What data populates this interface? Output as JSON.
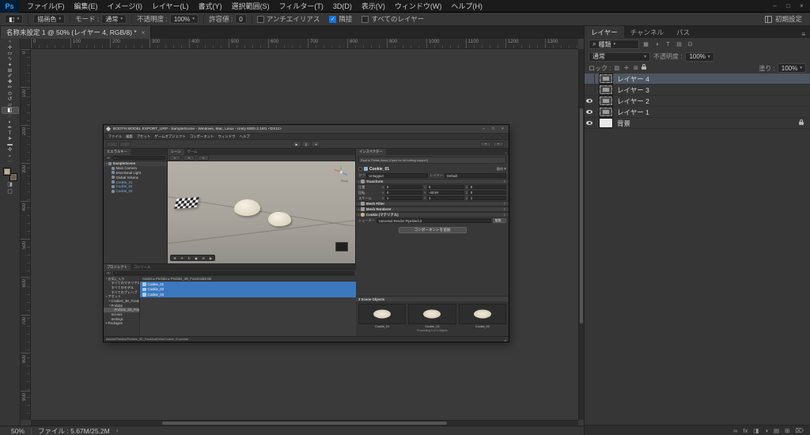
{
  "ps": {
    "logo": "Ps",
    "menus": [
      "ファイル(F)",
      "編集(E)",
      "イメージ(I)",
      "レイヤー(L)",
      "書式(Y)",
      "選択範囲(S)",
      "フィルター(T)",
      "3D(D)",
      "表示(V)",
      "ウィンドウ(W)",
      "ヘルプ(H)"
    ],
    "window_controls": [
      "–",
      "□",
      "×"
    ],
    "icons": {
      "caret": "▾",
      "dbl_arrow": "»",
      "check": "✓",
      "search": "⌕",
      "panel_menu": "≡",
      "chevron": "›",
      "tool_preset_glyph": "◧"
    },
    "options": {
      "fill_source": "描画色",
      "mode_label": "モード :",
      "mode_value": "通常",
      "opacity_label": "不透明度 :",
      "opacity_value": "100%",
      "tolerance_label": "許容値 :",
      "tolerance_value": "0",
      "checkbox_antialias": "アンチエイリアス",
      "checkbox_contiguous": "隣接",
      "checkbox_all_layers": "すべてのレイヤー",
      "workspace": "初期設定"
    },
    "document_tab": {
      "title": "名称未設定 1 @ 50% (レイヤー 4, RGB/8) *",
      "close": "×"
    },
    "tools": [
      {
        "name": "move-tool-icon",
        "glyph": "✛"
      },
      {
        "name": "marquee-tool-icon",
        "glyph": "▭"
      },
      {
        "name": "lasso-tool-icon",
        "glyph": "∿"
      },
      {
        "name": "magic-wand-tool-icon",
        "glyph": "✦"
      },
      {
        "name": "crop-tool-icon",
        "glyph": "⊞"
      },
      {
        "name": "eyedropper-tool-icon",
        "glyph": "✐"
      },
      {
        "name": "healing-brush-tool-icon",
        "glyph": "✚"
      },
      {
        "name": "brush-tool-icon",
        "glyph": "✏"
      },
      {
        "name": "clone-stamp-tool-icon",
        "glyph": "⊙"
      },
      {
        "name": "history-brush-tool-icon",
        "glyph": "↺"
      },
      {
        "name": "eraser-tool-icon",
        "glyph": "▱"
      },
      {
        "name": "paint-bucket-tool-icon",
        "glyph": "◧",
        "selected": true
      },
      {
        "name": "blur-tool-icon",
        "glyph": "◌"
      },
      {
        "name": "dodge-tool-icon",
        "glyph": "◐"
      },
      {
        "name": "pen-tool-icon",
        "glyph": "✒"
      },
      {
        "name": "type-tool-icon",
        "glyph": "T"
      },
      {
        "name": "path-select-tool-icon",
        "glyph": "➤"
      },
      {
        "name": "shape-tool-icon",
        "glyph": "▬"
      },
      {
        "name": "hand-tool-icon",
        "glyph": "✣"
      },
      {
        "name": "zoom-tool-icon",
        "glyph": "⌕"
      }
    ],
    "toolbar_more": "⋯",
    "swatches": {
      "foreground": "#c2ad8a",
      "background": "#6e5e44"
    },
    "rulers": {
      "top": [
        "0",
        "100",
        "200",
        "300",
        "400",
        "500",
        "600",
        "700",
        "800",
        "900",
        "1000",
        "1100",
        "1200",
        "1300"
      ],
      "left": [
        "0",
        "100",
        "200",
        "300",
        "400",
        "500",
        "600",
        "700",
        "800",
        "900"
      ]
    },
    "layers_panel": {
      "tabs": [
        {
          "label": "レイヤー",
          "active": true
        },
        {
          "label": "チャンネル"
        },
        {
          "label": "パス"
        }
      ],
      "filter_label": "種類",
      "filter_icons": [
        "▦",
        "◑",
        "T",
        "▤",
        "⊡"
      ],
      "blend_mode": "通常",
      "opacity_label": "不透明度 :",
      "opacity_value": "100%",
      "lock_label": "ロック :",
      "lock_icons": [
        "▨",
        "✛",
        "⊞"
      ],
      "fill_label": "塗り :",
      "fill_value": "100%",
      "layers": [
        {
          "name": "レイヤー 4",
          "selected": true,
          "eye_off": true
        },
        {
          "name": "レイヤー 3",
          "eye_off": true
        },
        {
          "name": "レイヤー 2"
        },
        {
          "name": "レイヤー 1"
        },
        {
          "name": "背景",
          "is_bg": true,
          "locked": true
        }
      ],
      "bottom_icons": [
        {
          "name": "link-layers-icon",
          "glyph": "∞"
        },
        {
          "name": "layer-style-icon",
          "glyph": "fx"
        },
        {
          "name": "layer-mask-icon",
          "glyph": "◨"
        },
        {
          "name": "adjustment-layer-icon",
          "glyph": "◑"
        },
        {
          "name": "layer-group-icon",
          "glyph": "▤"
        },
        {
          "name": "new-layer-icon",
          "glyph": "⊞"
        },
        {
          "name": "delete-layer-icon",
          "glyph": "⌦"
        }
      ]
    },
    "status_bar": {
      "zoom": "50%",
      "file_info": "ファイル : 5.67M/25.2M",
      "expander": "›"
    }
  },
  "unity": {
    "title": "BOOTH MODEL EXPORT_URP - SampleScene - Windows, Mac, Linux - Unity 6000.2.16f1 <DX11>",
    "window_controls": [
      "–",
      "□",
      "×"
    ],
    "menus": [
      "ファイル",
      "編集",
      "アセット",
      "ゲームオブジェクト",
      "コンポーネント",
      "ウィンドウ",
      "ヘルプ"
    ],
    "transport": [
      "▶",
      "∥",
      "⇥"
    ],
    "icons": {
      "caret": "▾",
      "search": "⌕",
      "plus": "+",
      "dots": "⋮",
      "menu": "≡",
      "grip": "◢"
    },
    "hierarchy": {
      "tab": "ヒエラルキー",
      "items": [
        {
          "label": "SampleScene",
          "depth": 0,
          "arrow": "▼",
          "scene": true
        },
        {
          "label": "Main Camera",
          "depth": 1
        },
        {
          "label": "Directional Light",
          "depth": 1
        },
        {
          "label": "Global Volume",
          "depth": 1
        },
        {
          "label": "Cookie_01",
          "depth": 1,
          "blue": true
        },
        {
          "label": "Cookie_02",
          "depth": 1,
          "blue": true
        },
        {
          "label": "Cookie_03",
          "depth": 1,
          "blue": true
        }
      ]
    },
    "scene": {
      "tabs": [
        {
          "label": "シーン",
          "active": true
        },
        {
          "label": "ゲーム"
        }
      ],
      "gizmo_label": "Persp",
      "tools": [
        {
          "name": "view-tool-icon",
          "glyph": "✥"
        },
        {
          "name": "move-tool-icon",
          "glyph": "✛"
        },
        {
          "name": "rotate-tool-icon",
          "glyph": "↻"
        },
        {
          "name": "scale-tool-icon",
          "glyph": "▣"
        },
        {
          "name": "rect-tool-icon",
          "glyph": "⊞"
        },
        {
          "name": "transform-tool-icon",
          "glyph": "◉"
        }
      ]
    },
    "inspector": {
      "tab": "インスペクター",
      "prefab_notice": "Root in Prefab Asset (Open for full editing support)",
      "object_name": "Cookie_01",
      "static_label": "静的",
      "tag_label": "タグ",
      "tag_value": "Untagged",
      "layer_label": "レイヤー",
      "layer_value": "Default",
      "transform": {
        "title": "Transform",
        "axis_labels": [
          "X",
          "Y",
          "Z"
        ],
        "rows": [
          {
            "label": "位置",
            "x": "0",
            "y": "0",
            "z": "0"
          },
          {
            "label": "回転",
            "x": "0",
            "y": "-43.94",
            "z": "0"
          },
          {
            "label": "スケール",
            "x": "1",
            "y": "1",
            "z": "1"
          }
        ]
      },
      "components": [
        {
          "title": "Mesh Filter"
        },
        {
          "title": "Mesh Renderer"
        },
        {
          "title": "Cookie (マテリアル)"
        }
      ],
      "shader_label": "シェーダー",
      "shader_value": "Universal Render Pipeline/Lit",
      "shader_edit": "編集...",
      "add_component": "コンポーネントを追加",
      "preview_header": "3 Scene Objects",
      "previews": [
        {
          "name": "Cookie_01"
        },
        {
          "name": "Cookie_02",
          "note": "Processing 3 of 3 Objects"
        },
        {
          "name": "Cookie_03"
        }
      ]
    },
    "project": {
      "tabs": [
        {
          "label": "プロジェクト",
          "active": true
        },
        {
          "label": "コンソール"
        }
      ],
      "tree": [
        {
          "label": "お気に入り",
          "depth": 0,
          "arrow": "▼"
        },
        {
          "label": "すべてのマテリアル",
          "depth": 1
        },
        {
          "label": "すべてのモデル",
          "depth": 1
        },
        {
          "label": "すべてのプレハブ",
          "depth": 1
        },
        {
          "label": "アセット",
          "depth": 0,
          "arrow": "▼"
        },
        {
          "label": "Cookies_3D_FoodAndDrink",
          "depth": 1,
          "arrow": "▶"
        },
        {
          "label": "Prefabs",
          "depth": 1,
          "arrow": "▼"
        },
        {
          "label": "Prefabs_3D_FoodAndDrink",
          "depth": 2,
          "selected": true
        },
        {
          "label": "Scenes",
          "depth": 1
        },
        {
          "label": "Settings",
          "depth": 1
        },
        {
          "label": "Packages",
          "depth": 0,
          "arrow": "▶"
        }
      ],
      "breadcrumb": "Assets ▸ Prefabs ▸ Prefabs_3D_FoodAndDrink",
      "files": [
        {
          "name": "Cookie_01",
          "selected": true
        },
        {
          "name": "Cookie_02",
          "selected": true
        },
        {
          "name": "Cookie_03",
          "selected": true
        }
      ],
      "path": "Assets/Prefabs/Prefabs_3D_FoodAndDrink/Cookie_01.prefab"
    }
  }
}
